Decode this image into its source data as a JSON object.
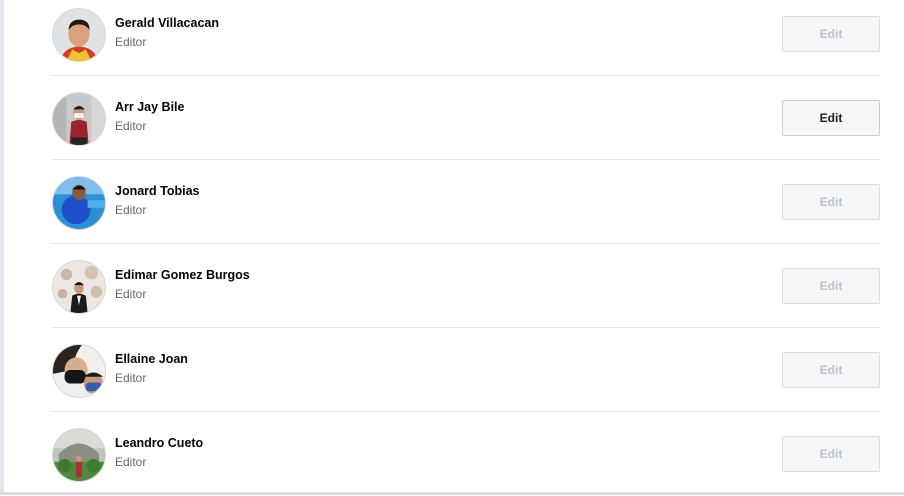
{
  "members": [
    {
      "name": "Gerald Villacacan",
      "role": "Editor",
      "edit_label": "Edit",
      "edit_enabled": false
    },
    {
      "name": "Arr Jay Bile",
      "role": "Editor",
      "edit_label": "Edit",
      "edit_enabled": true
    },
    {
      "name": "Jonard Tobias",
      "role": "Editor",
      "edit_label": "Edit",
      "edit_enabled": false
    },
    {
      "name": "Edimar Gomez Burgos",
      "role": "Editor",
      "edit_label": "Edit",
      "edit_enabled": false
    },
    {
      "name": "Ellaine Joan",
      "role": "Editor",
      "edit_label": "Edit",
      "edit_enabled": false
    },
    {
      "name": "Leandro Cueto",
      "role": "Editor",
      "edit_label": "Edit",
      "edit_enabled": false
    }
  ]
}
